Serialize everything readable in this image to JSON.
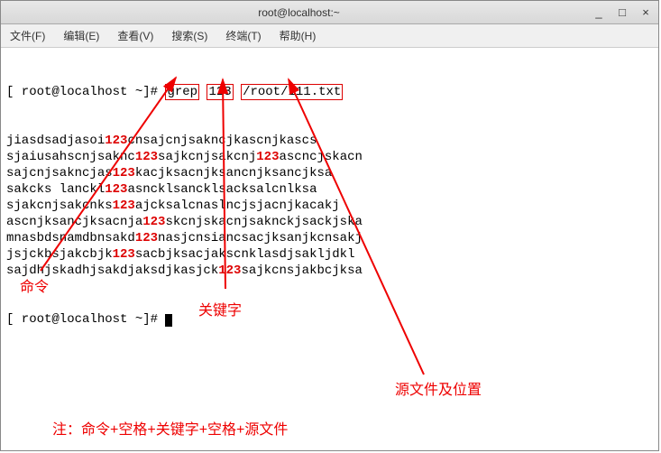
{
  "titlebar": {
    "title": "root@localhost:~",
    "minimize": "_",
    "maximize": "□",
    "close": "×"
  },
  "menubar": {
    "file": "文件(F)",
    "edit": "编辑(E)",
    "view": "查看(V)",
    "search": "搜索(S)",
    "terminal": "终端(T)",
    "help": "帮助(H)"
  },
  "terminal": {
    "prompt1_pre": "[ root@localhost ~]# ",
    "cmd": "grep",
    "sp1": " ",
    "keyword": "123",
    "sp2": " ",
    "filepath": "/root/111.txt",
    "lines": [
      {
        "pre": "jiasdsadjasoi",
        "hl": "123",
        "post": "cnsajcnjsakncjkascnjkascs"
      },
      {
        "pre": "sjaiusahscnjsaknc",
        "hl": "123",
        "post": "sajkcnjsakcnj123ascncjskacn"
      },
      {
        "pre": "sajcnjsakncjas",
        "hl": "123",
        "post": "kacjksacnjksancnjksancjksa"
      },
      {
        "pre": "sakcks lanckl",
        "hl": "123",
        "post": "asncklsancklsacksalcnlksa"
      },
      {
        "pre": "sjakcnjsakcnks",
        "hl": "123",
        "post": "ajcksalcnaslncjsjacnjkacakj"
      },
      {
        "pre": "ascnjksancjksacnja",
        "hl": "123",
        "post": "skcnjskacnjsaknckjsackjska"
      },
      {
        "pre": "mnasbdsnamdbnsakd",
        "hl": "123",
        "post": "nasjcnsiancsacjksanjkcnsakj"
      },
      {
        "pre": "jsjckbsjakcbjk",
        "hl": "123",
        "post": "sacbjksacjakscnklasdjsakljdkl"
      },
      {
        "pre": "sajdhjskadhjsakdjaksdjkasjck",
        "hl": "123",
        "post": "sajkcnsjakbcjksa"
      }
    ],
    "prompt2": "[ root@localhost ~]# "
  },
  "annotations": {
    "cmd_label": "命令",
    "keyword_label": "关键字",
    "filepath_label": "源文件及位置",
    "note": "注：命令+空格+关键字+空格+源文件"
  }
}
